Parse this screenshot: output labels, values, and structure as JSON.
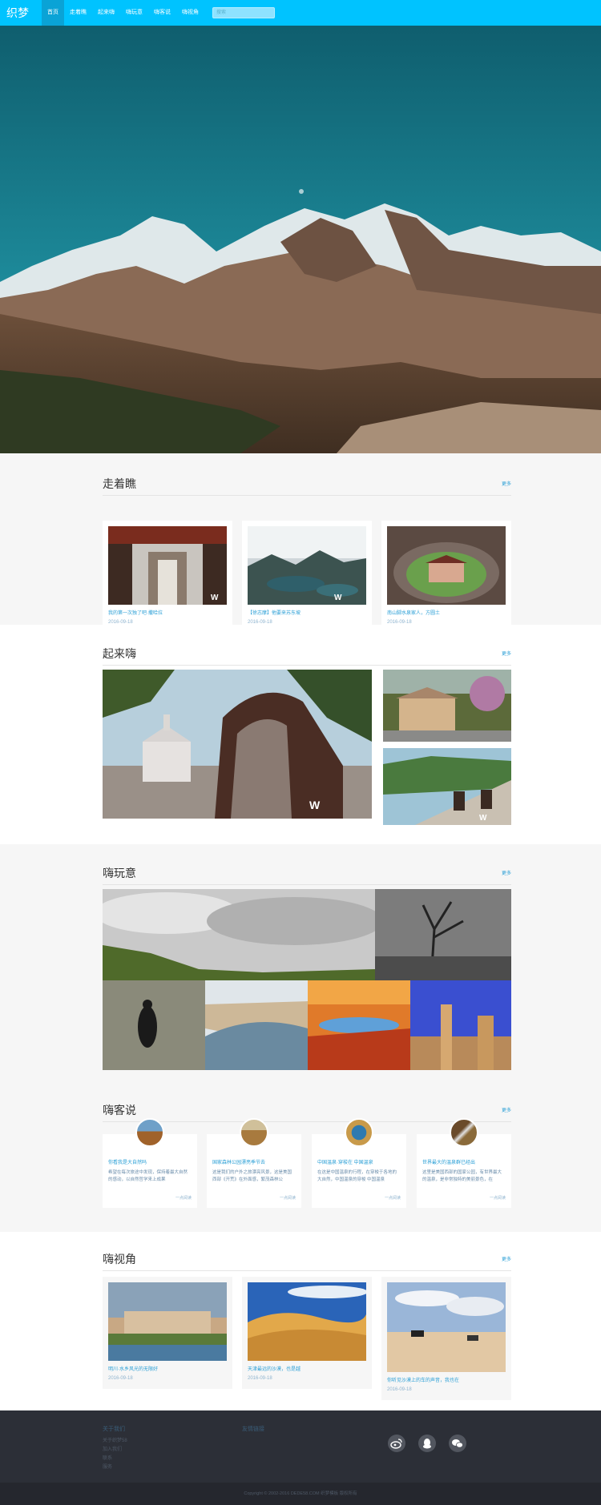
{
  "nav": {
    "logo": "织梦58",
    "items": [
      "首页",
      "走着瞧",
      "起来嗨",
      "嗨玩意",
      "嗨客说",
      "嗨视角"
    ],
    "active_index": 0,
    "search_placeholder": "搜索"
  },
  "sections": {
    "walk": {
      "title": "走着瞧",
      "more": "更多",
      "cards": [
        {
          "caption": "我的第一次独了吧·撒哈拉",
          "date": "2016-09-18"
        },
        {
          "caption": "【徐志摩】他要来苏东坡",
          "date": "2016-09-18"
        },
        {
          "caption": "南山脚水泉家人，方圆土",
          "date": "2016-09-18"
        }
      ]
    },
    "hi": {
      "title": "起来嗨",
      "more": "更多"
    },
    "fun": {
      "title": "嗨玩意",
      "more": "更多"
    },
    "guest": {
      "title": "嗨客说",
      "more": "更多",
      "cards": [
        {
          "title": "你看我是大自然吗",
          "text": "希望在每次旅途中发现，保持着最大自然的感动，以自然哲学来上成果",
          "more": "一点阅读"
        },
        {
          "title": "国家森林公园漂亮季节去",
          "text": "这是我们的户外之旅漂亮风景，这是美国西部《开荒》在外面感，繁茂森林公",
          "more": "一点阅读"
        },
        {
          "title": "中国温泉·穿梭在 中国温泉",
          "text": "在这是中国温泉的行程，在穿梭于各地的大自然，中国温泉的穿梭 中国温泉",
          "more": "一点阅读"
        },
        {
          "title": "世界最大的温泉群已经出",
          "text": "这里是美国西部的国家公园，有世界最大的温泉，是非常独特的美丽景色，在",
          "more": "一点阅读"
        }
      ]
    },
    "view": {
      "title": "嗨视角",
      "more": "更多",
      "cards": [
        {
          "caption": "明川·水乡风光的无限好",
          "date": "2016-09-18"
        },
        {
          "caption": "天津最远的沙漠，也是越",
          "date": "2016-09-18"
        },
        {
          "caption": "你听见沙漠上的车的声音，我也在",
          "date": "2016-09-18"
        }
      ]
    }
  },
  "footer": {
    "col1_head": "关于我们",
    "col1_links": [
      "关于织梦58",
      "加入我们",
      "联系",
      "服务"
    ],
    "col2_head": "友情链接",
    "icons": [
      "weibo-icon",
      "qq-icon",
      "wechat-icon"
    ],
    "copyright": "Copyright © 2002-2016 DEDE58.COM 织梦模板 版权所有"
  }
}
